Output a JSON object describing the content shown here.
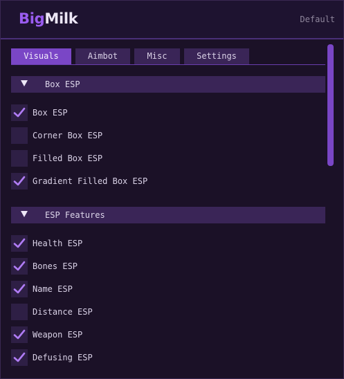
{
  "app": {
    "brand_part1": "Big",
    "brand_part2": "Milk",
    "profile": "Default"
  },
  "tabs": [
    {
      "label": "Visuals",
      "active": true
    },
    {
      "label": "Aimbot",
      "active": false
    },
    {
      "label": "Misc",
      "active": false
    },
    {
      "label": "Settings",
      "active": false
    }
  ],
  "sections": [
    {
      "title": "Box ESP",
      "expanded": true,
      "items": [
        {
          "label": "Box ESP",
          "checked": true
        },
        {
          "label": "Corner Box ESP",
          "checked": false
        },
        {
          "label": "Filled Box ESP",
          "checked": false
        },
        {
          "label": "Gradient Filled Box ESP",
          "checked": true
        }
      ]
    },
    {
      "title": "ESP Features",
      "expanded": true,
      "items": [
        {
          "label": "Health ESP",
          "checked": true
        },
        {
          "label": "Bones ESP",
          "checked": true
        },
        {
          "label": "Name ESP",
          "checked": true
        },
        {
          "label": "Distance ESP",
          "checked": false
        },
        {
          "label": "Weapon ESP",
          "checked": true
        },
        {
          "label": "Defusing ESP",
          "checked": true
        }
      ]
    }
  ],
  "colors": {
    "accent": "#7a46c6",
    "check": "#b07cf5",
    "background": "#1b1127",
    "panel": "#3a2557"
  },
  "icons": {
    "section_toggle": "triangle-down-icon",
    "check": "check-icon"
  }
}
